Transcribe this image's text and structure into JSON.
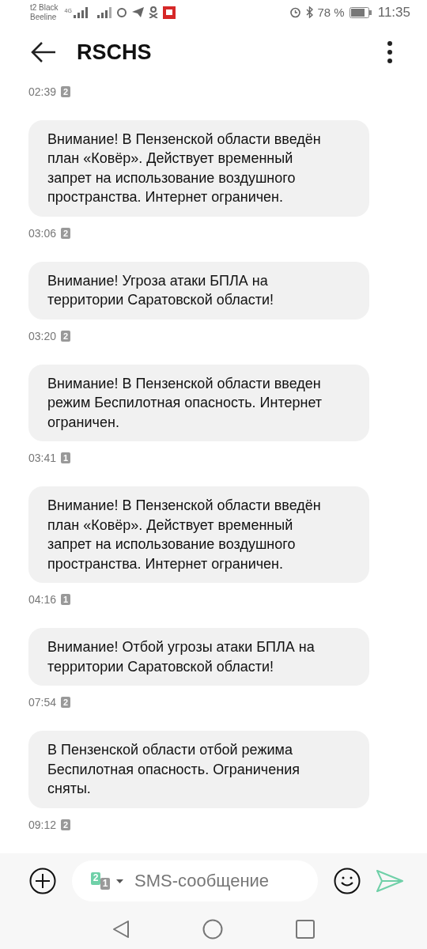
{
  "status_bar": {
    "carrier_1": "t2 Black",
    "carrier_2": "Beeline",
    "network": "4G",
    "battery": "78 %",
    "time": "11:35"
  },
  "header": {
    "title": "RSCHS"
  },
  "timeline": [
    {
      "kind": "timestamp",
      "time": "02:39",
      "sim": "2"
    },
    {
      "kind": "message",
      "text": "Внимание! В Пензенской области введён план «Ковёр». Действует временный запрет на использование воздушного пространства. Интернет ограничен."
    },
    {
      "kind": "timestamp",
      "time": "03:06",
      "sim": "2"
    },
    {
      "kind": "message",
      "text": "Внимание! Угроза атаки БПЛА на территории Саратовской области!"
    },
    {
      "kind": "timestamp",
      "time": "03:20",
      "sim": "2"
    },
    {
      "kind": "message",
      "text": "Внимание! В Пензенской области введен режим Беспилотная опасность. Интернет ограничен."
    },
    {
      "kind": "timestamp",
      "time": "03:41",
      "sim": "1"
    },
    {
      "kind": "message",
      "text": "Внимание! В Пензенской области введён план «Ковёр». Действует временный запрет на использование воздушного пространства. Интернет ограничен."
    },
    {
      "kind": "timestamp",
      "time": "04:16",
      "sim": "1"
    },
    {
      "kind": "message",
      "text": "Внимание! Отбой угрозы атаки БПЛА на территории Саратовской области!"
    },
    {
      "kind": "timestamp",
      "time": "07:54",
      "sim": "2"
    },
    {
      "kind": "message",
      "text": "В Пензенской области отбой режима Беспилотная опасность.  Ограничения сняты."
    },
    {
      "kind": "timestamp",
      "time": "09:12",
      "sim": "2"
    }
  ],
  "composer": {
    "sim_front": "2",
    "sim_back": "1",
    "placeholder": "SMS-сообщение"
  }
}
